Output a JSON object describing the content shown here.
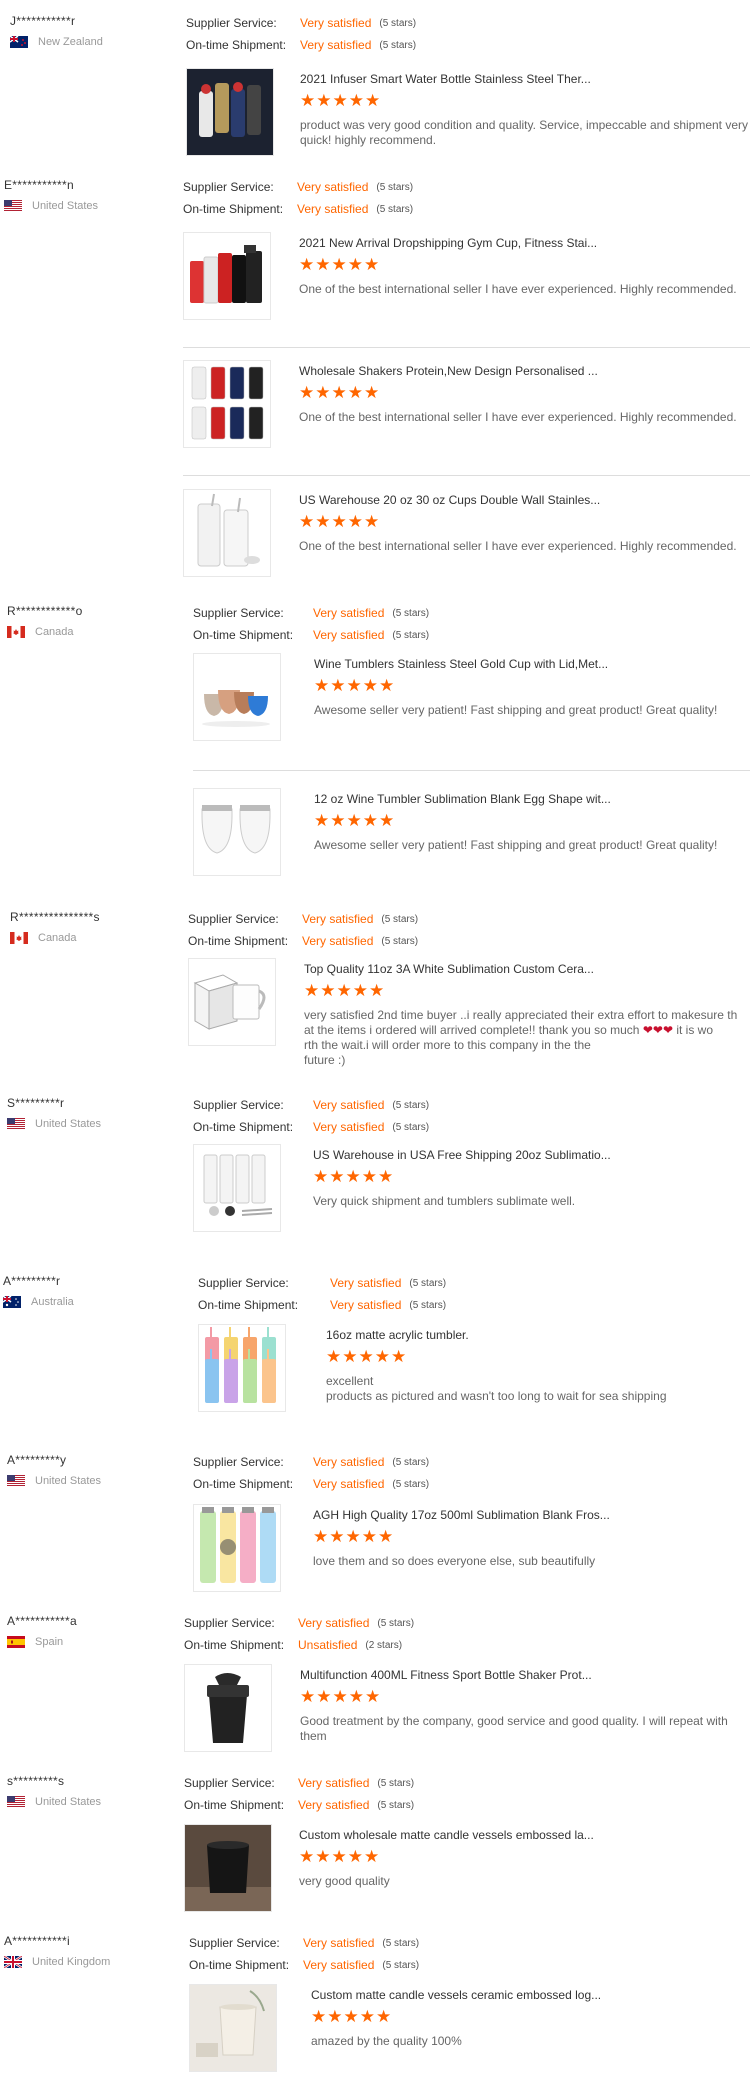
{
  "labels": {
    "supplier_service": "Supplier Service:",
    "ontime_shipment": "On-time Shipment:"
  },
  "star_glyphs": "★★★★★",
  "reviews": [
    {
      "buyer": "J***********r",
      "country": "New Zealand",
      "flag": "nz",
      "supplier_value": "Very satisfied",
      "supplier_stars": "(5 stars)",
      "shipment_value": "Very satisfied",
      "shipment_stars": "(5 stars)",
      "products": [
        {
          "title": "2021 Infuser Smart Water Bottle Stainless Steel Ther...",
          "rating": 5,
          "comment": "product was very good condition and quality. Service, impeccable and shipment very quick! highly recommend.",
          "image": "dark-bottles-icon"
        }
      ]
    },
    {
      "buyer": "E***********n",
      "country": "United States",
      "flag": "us",
      "supplier_value": "Very satisfied",
      "supplier_stars": "(5 stars)",
      "shipment_value": "Very satisfied",
      "shipment_stars": "(5 stars)",
      "products": [
        {
          "title": "2021 New Arrival Dropshipping Gym Cup, Fitness Stai...",
          "rating": 5,
          "comment": "One of the best international seller I have ever experienced. Highly recommended.",
          "image": "shaker-bottles-icon"
        },
        {
          "title": "Wholesale Shakers Protein,New Design Personalised ...",
          "rating": 5,
          "comment": "One of the best international seller I have ever experienced. Highly recommended.",
          "image": "shaker-grid-icon"
        },
        {
          "title": "US Warehouse 20 oz 30 oz Cups Double Wall Stainles...",
          "rating": 5,
          "comment": "One of the best international seller I have ever experienced. Highly recommended.",
          "image": "white-tumblers-icon"
        }
      ]
    },
    {
      "buyer": "R************o",
      "country": "Canada",
      "flag": "ca",
      "supplier_value": "Very satisfied",
      "supplier_stars": "(5 stars)",
      "shipment_value": "Very satisfied",
      "shipment_stars": "(5 stars)",
      "products": [
        {
          "title": "Wine Tumblers Stainless Steel Gold Cup with Lid,Met...",
          "rating": 5,
          "comment": "Awesome seller very patient! Fast shipping and great product! Great quality!",
          "image": "wine-tumblers-icon"
        },
        {
          "title": "12 oz Wine Tumbler Sublimation Blank Egg Shape wit...",
          "rating": 5,
          "comment": "Awesome seller very patient! Fast shipping and great product! Great quality!",
          "image": "egg-tumblers-icon"
        }
      ]
    },
    {
      "buyer": "R***************s",
      "country": "Canada",
      "flag": "ca",
      "supplier_value": "Very satisfied",
      "supplier_stars": "(5 stars)",
      "shipment_value": "Very satisfied",
      "shipment_stars": "(5 stars)",
      "products": [
        {
          "title": "Top Quality 11oz 3A White Sublimation Custom Cera...",
          "rating": 5,
          "comment_lines": [
            "very satisfied 2nd time buyer ..i really appreciated their extra effort to makesure th",
            "at the items  i ordered will arrived complete!! thank you so much",
            " it is wo",
            "rth the wait.i will order more to this company in the the",
            "future :)"
          ],
          "hearts": "❤❤❤",
          "image": "white-mug-icon"
        }
      ]
    },
    {
      "buyer": "S*********r",
      "country": "United States",
      "flag": "us",
      "supplier_value": "Very satisfied",
      "supplier_stars": "(5 stars)",
      "shipment_value": "Very satisfied",
      "shipment_stars": "(5 stars)",
      "products": [
        {
          "title": "US Warehouse in USA Free Shipping 20oz Sublimatio...",
          "rating": 5,
          "comment": "Very quick shipment and tumblers sublimate well.",
          "image": "skinny-tumblers-icon"
        }
      ]
    },
    {
      "buyer": "A*********r",
      "country": "Australia",
      "flag": "au",
      "supplier_value": "Very satisfied",
      "supplier_stars": "(5 stars)",
      "shipment_value": "Very satisfied",
      "shipment_stars": "(5 stars)",
      "products": [
        {
          "title": "16oz matte acrylic tumbler.",
          "rating": 5,
          "comment_lines": [
            "excellent",
            "products as pictured and wasn't too long to wait for sea shipping"
          ],
          "image": "colorful-tumblers-icon"
        }
      ]
    },
    {
      "buyer": "A*********y",
      "country": "United States",
      "flag": "us",
      "supplier_value": "Very satisfied",
      "supplier_stars": "(5 stars)",
      "shipment_value": "Very satisfied",
      "shipment_stars": "(5 stars)",
      "products": [
        {
          "title": "AGH High Quality 17oz 500ml Sublimation Blank Fros...",
          "rating": 5,
          "comment": "love them and so does everyone else, sub beautifully",
          "image": "printed-bottles-icon"
        }
      ]
    },
    {
      "buyer": "A***********a",
      "country": "Spain",
      "flag": "es",
      "supplier_value": "Very satisfied",
      "supplier_stars": "(5 stars)",
      "shipment_value": "Unsatisfied",
      "shipment_stars": "(2 stars)",
      "products": [
        {
          "title": "Multifunction 400ML Fitness Sport Bottle Shaker Prot...",
          "rating": 5,
          "comment": "Good treatment by the company, good service and good quality. I will repeat with them",
          "image": "black-shaker-icon"
        }
      ]
    },
    {
      "buyer": "s*********s",
      "country": "United States",
      "flag": "us",
      "supplier_value": "Very satisfied",
      "supplier_stars": "(5 stars)",
      "shipment_value": "Very satisfied",
      "shipment_stars": "(5 stars)",
      "products": [
        {
          "title": "Custom wholesale matte candle vessels embossed la...",
          "rating": 5,
          "comment": "very good quality",
          "image": "black-candle-vessel-icon"
        }
      ]
    },
    {
      "buyer": "A***********i",
      "country": "United Kingdom",
      "flag": "uk",
      "supplier_value": "Very satisfied",
      "supplier_stars": "(5 stars)",
      "shipment_value": "Very satisfied",
      "shipment_stars": "(5 stars)",
      "products": [
        {
          "title": "Custom matte candle vessels ceramic embossed log...",
          "rating": 5,
          "comment": "amazed by the quality 100%",
          "image": "cream-candle-vessel-icon"
        }
      ]
    }
  ],
  "colors": {
    "accent": "#ff6600",
    "star": "#ff6600",
    "divider": "#dddddd"
  }
}
